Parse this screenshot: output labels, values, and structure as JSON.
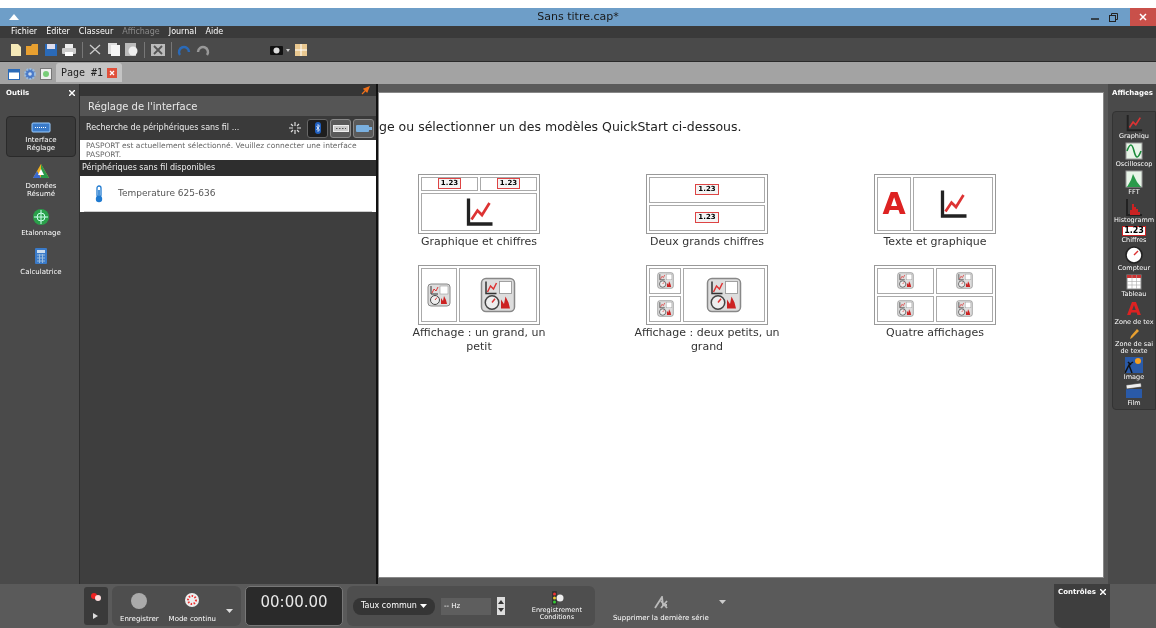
{
  "window": {
    "title": "Sans titre.cap*"
  },
  "menu": [
    {
      "label": "Fichier",
      "disabled": false
    },
    {
      "label": "Éditer",
      "disabled": false
    },
    {
      "label": "Classeur",
      "disabled": false
    },
    {
      "label": "Affichage",
      "disabled": true
    },
    {
      "label": "Journal",
      "disabled": false
    },
    {
      "label": "Aide",
      "disabled": false
    }
  ],
  "page_tabs": [
    {
      "label": "Page #1",
      "selected": true
    }
  ],
  "tools_panel": {
    "title": "Outils",
    "items": [
      {
        "label": "Interface Réglage",
        "selected": true
      },
      {
        "label": "Données Résumé",
        "selected": false
      },
      {
        "label": "Etalonnage",
        "selected": false
      },
      {
        "label": "Calculatrice",
        "selected": false
      }
    ]
  },
  "setup_panel": {
    "title": "Réglage de l'interface",
    "search_status": "Recherche de périphériques sans fil ...",
    "connections": [
      {
        "kind": "bluetooth",
        "selected": true
      },
      {
        "kind": "usb",
        "selected": false
      },
      {
        "kind": "cable",
        "selected": false
      }
    ],
    "message": "PASPORT est actuellement sélectionné. Veuillez connecter une interface PASPORT.",
    "section": "Périphériques sans fil disponibles",
    "devices": [
      {
        "name": "Temperature 625-636",
        "kind": "temperature"
      }
    ]
  },
  "canvas": {
    "instruction": "ge ou sélectionner un des modèles QuickStart ci-dessous.",
    "templates": [
      {
        "label": "Graphique et chiffres",
        "panels": [
          {
            "kind": "digits",
            "text": "1.23"
          },
          {
            "kind": "digits",
            "text": "1.23"
          },
          {
            "kind": "graph"
          }
        ]
      },
      {
        "label": "Deux grands chiffres",
        "panels": [
          {
            "kind": "digits",
            "text": "1.23"
          },
          {
            "kind": "digits",
            "text": "1.23"
          }
        ]
      },
      {
        "label": "Texte et graphique",
        "panels": [
          {
            "kind": "text",
            "text": "A"
          },
          {
            "kind": "graph"
          }
        ]
      },
      {
        "label": "Affichage : un grand, un petit",
        "panels": [
          {
            "kind": "display"
          },
          {
            "kind": "display"
          }
        ]
      },
      {
        "label": "Affichage : deux petits, un grand",
        "panels": [
          {
            "kind": "display"
          },
          {
            "kind": "display"
          },
          {
            "kind": "display"
          }
        ]
      },
      {
        "label": "Quatre affichages",
        "panels": [
          {
            "kind": "display"
          },
          {
            "kind": "display"
          },
          {
            "kind": "display"
          },
          {
            "kind": "display"
          }
        ]
      }
    ]
  },
  "displays_panel": {
    "title": "Affichages",
    "items": [
      {
        "label": "Graphiqu"
      },
      {
        "label": "Oscilloscop"
      },
      {
        "label": "FFT"
      },
      {
        "label": "Histogramm"
      },
      {
        "label": "Chiffres",
        "icon_text": "1.23"
      },
      {
        "label": "Compteur"
      },
      {
        "label": "Tableau"
      },
      {
        "label": "Zone de tex",
        "icon_text": "A"
      },
      {
        "label": "Zone de sai de texte"
      },
      {
        "label": "Image"
      },
      {
        "label": "Film"
      }
    ]
  },
  "controls": {
    "record": "Enregistrer",
    "mode": "Mode continu",
    "timer": "00:00.00",
    "rate": "Taux commun",
    "frequency": "-- Hz",
    "conditions": "Enregistrement Conditions",
    "delete": "Supprimer la dernière série",
    "panel_title": "Contrôles"
  }
}
